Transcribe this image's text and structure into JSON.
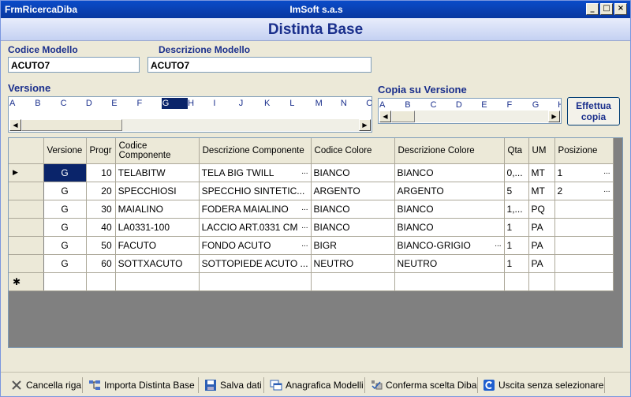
{
  "window": {
    "form_name": "FrmRicercaDiba",
    "app_title": "ImSoft s.a.s",
    "controls": {
      "minimize": "_",
      "maximize": "□",
      "close": "×"
    }
  },
  "header": {
    "title": "Distinta Base"
  },
  "codice_modello": {
    "label": "Codice Modello",
    "value": "ACUTO7"
  },
  "descrizione_modello": {
    "label": "Descrizione Modello",
    "value": "ACUTO7"
  },
  "versione": {
    "label": "Versione",
    "letters": [
      "A",
      "B",
      "C",
      "D",
      "E",
      "F",
      "G",
      "H",
      "I",
      "J",
      "K",
      "L",
      "M",
      "N",
      "O"
    ],
    "selected": "G"
  },
  "copia_versione": {
    "label": "Copia su Versione",
    "letters": [
      "A",
      "B",
      "C",
      "D",
      "E",
      "F",
      "G",
      "H"
    ]
  },
  "effettua_copia": {
    "line1": "Effettua",
    "line2": "copia"
  },
  "scroll_glyphs": {
    "left": "◀",
    "right": "▶"
  },
  "grid": {
    "columns": [
      "Versione",
      "Progr",
      "Codice Componente",
      "Descrizione Componente",
      "Codice Colore",
      "Descrizione Colore",
      "Qta",
      "UM",
      "Posizione"
    ],
    "row_marker_current": "▶",
    "row_marker_new": "✱",
    "rows": [
      {
        "versione": "G",
        "progr": "10",
        "codice": "TELABITW",
        "descrizione": "TELA BIG TWILL",
        "desc_ellipsis": "...",
        "codice_colore": "BIANCO",
        "desc_colore": "BIANCO",
        "colore_ellipsis": "",
        "qta": "0,...",
        "um": "MT",
        "posizione": "1",
        "pos_ellipsis": "..."
      },
      {
        "versione": "G",
        "progr": "20",
        "codice": "SPECCHIOSI",
        "descrizione": "SPECCHIO SINTETIC...",
        "desc_ellipsis": "",
        "codice_colore": "ARGENTO",
        "desc_colore": "ARGENTO",
        "colore_ellipsis": "",
        "qta": "5",
        "um": "MT",
        "posizione": "2",
        "pos_ellipsis": "..."
      },
      {
        "versione": "G",
        "progr": "30",
        "codice": "MAIALINO",
        "descrizione": "FODERA MAIALINO",
        "desc_ellipsis": "...",
        "codice_colore": "BIANCO",
        "desc_colore": "BIANCO",
        "colore_ellipsis": "",
        "qta": "1,...",
        "um": "PQ",
        "posizione": "",
        "pos_ellipsis": ""
      },
      {
        "versione": "G",
        "progr": "40",
        "codice": "LA0331-100",
        "descrizione": "LACCIO ART.0331 CM",
        "desc_ellipsis": "...",
        "codice_colore": "BIANCO",
        "desc_colore": "BIANCO",
        "colore_ellipsis": "",
        "qta": "1",
        "um": "PA",
        "posizione": "",
        "pos_ellipsis": ""
      },
      {
        "versione": "G",
        "progr": "50",
        "codice": "FACUTO",
        "descrizione": "FONDO ACUTO",
        "desc_ellipsis": "...",
        "codice_colore": "BIGR",
        "desc_colore": "BIANCO-GRIGIO",
        "colore_ellipsis": "...",
        "qta": "1",
        "um": "PA",
        "posizione": "",
        "pos_ellipsis": ""
      },
      {
        "versione": "G",
        "progr": "60",
        "codice": "SOTTXACUTO",
        "descrizione": "SOTTOPIEDE ACUTO ...",
        "desc_ellipsis": "",
        "codice_colore": "NEUTRO",
        "desc_colore": "NEUTRO",
        "colore_ellipsis": "",
        "qta": "1",
        "um": "PA",
        "posizione": "",
        "pos_ellipsis": ""
      }
    ]
  },
  "toolbar": {
    "cancella": "Cancella riga",
    "importa": "Importa Distinta Base",
    "salva": "Salva dati",
    "anagrafica": "Anagrafica Modelli",
    "conferma": "Conferma scelta Diba",
    "uscita": "Uscita senza selezionare"
  }
}
